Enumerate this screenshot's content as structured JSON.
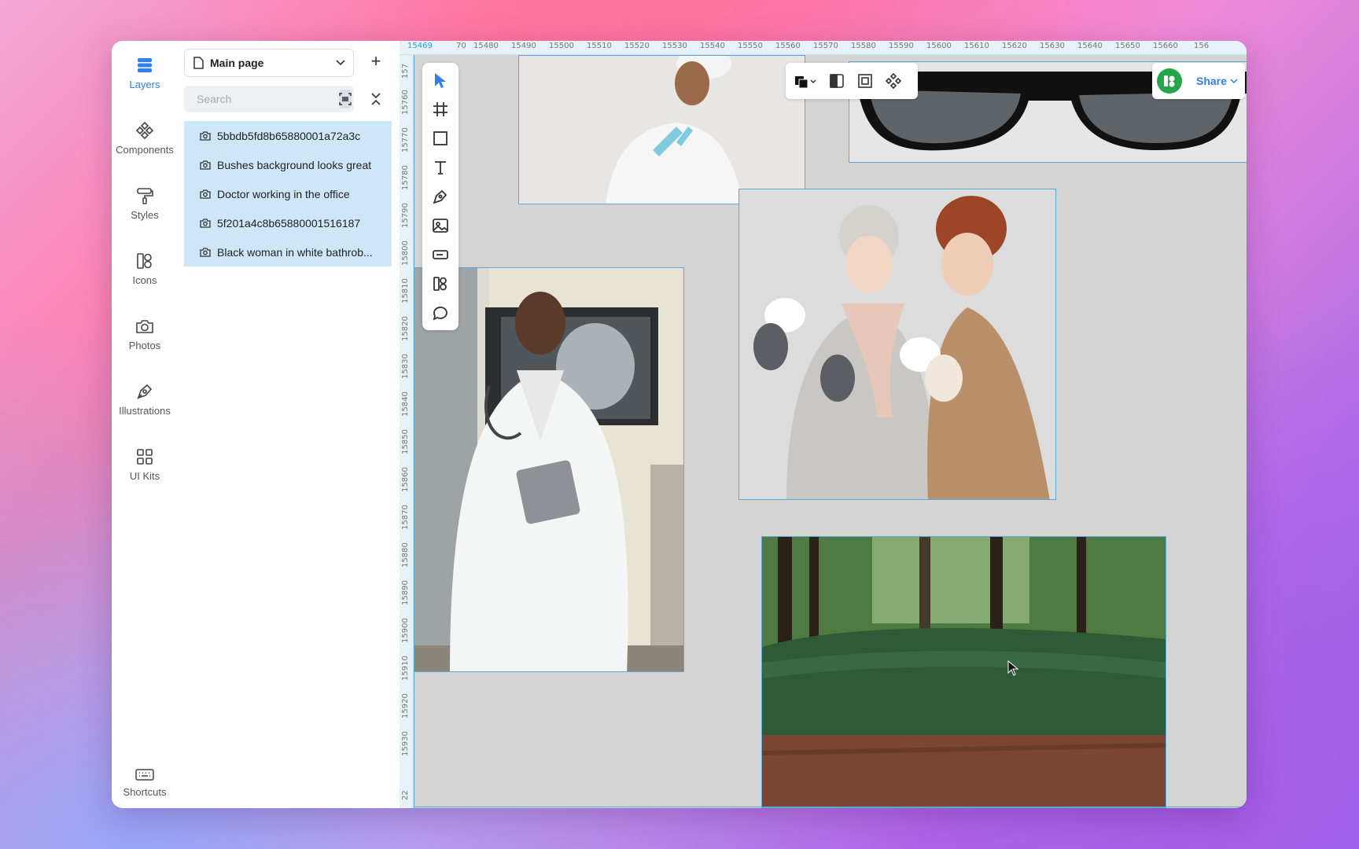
{
  "rail": {
    "items": [
      {
        "label": "Layers",
        "icon": "layers-icon",
        "active": true
      },
      {
        "label": "Components",
        "icon": "components-icon"
      },
      {
        "label": "Styles",
        "icon": "paint-roller-icon"
      },
      {
        "label": "Icons",
        "icon": "icons-icon"
      },
      {
        "label": "Photos",
        "icon": "camera-icon"
      },
      {
        "label": "Illustrations",
        "icon": "pen-icon"
      },
      {
        "label": "UI Kits",
        "icon": "grid-icon"
      }
    ],
    "shortcuts_label": "Shortcuts"
  },
  "panel": {
    "page_select": "Main page",
    "search_placeholder": "Search",
    "layers": [
      "5bbdb5fd8b65880001a72a3c",
      "Bushes background looks great",
      "Doctor working in the office",
      "5f201a4c8b65880001516187",
      "Black woman in white bathrob..."
    ]
  },
  "ruler": {
    "top_ticks": [
      "15469",
      "70",
      "15480",
      "15490",
      "15500",
      "15510",
      "15520",
      "15530",
      "15540",
      "15550",
      "15560",
      "15570",
      "15580",
      "15590",
      "15600",
      "15610",
      "15620",
      "15630",
      "15640",
      "15650",
      "15660",
      "156"
    ],
    "left_ticks": [
      "157",
      "15760",
      "15770",
      "15780",
      "15790",
      "15800",
      "15810",
      "15820",
      "15830",
      "15840",
      "15850",
      "15860",
      "15870",
      "15880",
      "15890",
      "15900",
      "15910",
      "15920",
      "15930",
      "22"
    ]
  },
  "share": {
    "label": "Share"
  },
  "colors": {
    "accent": "#2f7ff0",
    "selection": "#cde6f8",
    "canvas": "#d4d4d4",
    "frame_border": "#5aa9d6"
  }
}
